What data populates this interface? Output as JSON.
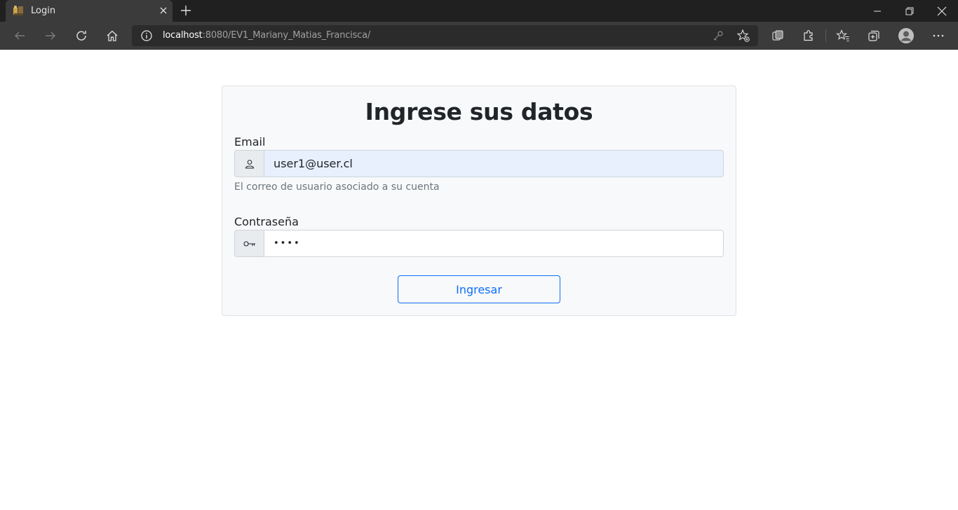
{
  "browser": {
    "tab_title": "Login",
    "url_host": "localhost",
    "url_rest": ":8080/EV1_Mariany_Matias_Francisca/"
  },
  "icons": {
    "favicon": "app-favicon-icon",
    "tab_close": "close-icon",
    "new_tab": "plus-icon",
    "back": "arrow-left-icon",
    "forward": "arrow-right-icon",
    "reload": "reload-icon",
    "home": "home-icon",
    "site_info": "info-icon",
    "password_key": "key-icon",
    "add_favorite": "star-plus-icon",
    "user": "user-icon",
    "key_field": "key-icon"
  },
  "form": {
    "title": "Ingrese sus datos",
    "email_label": "Email",
    "email_value": "user1@user.cl",
    "email_help": "El correo de usuario asociado a su cuenta",
    "password_label": "Contraseña",
    "password_value": "••••",
    "submit_label": "Ingresar"
  },
  "colors": {
    "primary": "#0d6efd",
    "autofill_bg": "#e8f0fe",
    "card_bg": "#f8f9fa",
    "chrome_dark": "#202020",
    "chrome_toolbar": "#3b3b3b"
  }
}
